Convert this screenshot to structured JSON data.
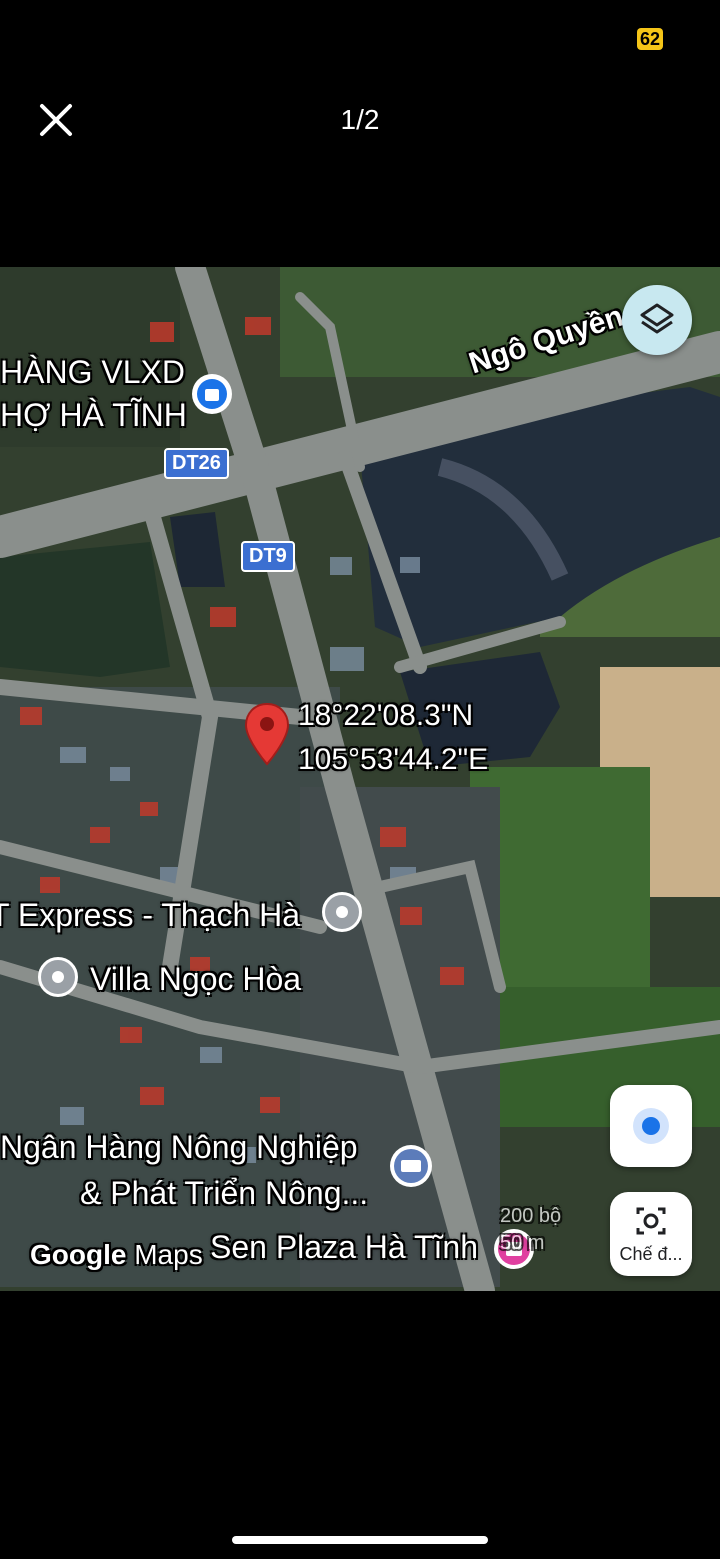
{
  "status_bar": {
    "badge": "62"
  },
  "header": {
    "page_counter": "1/2"
  },
  "map": {
    "places": {
      "store_line1": "HÀNG VLXD",
      "store_line2": "HỢ HÀ TĨNH",
      "street_name": "Ngô Quyền",
      "road_dt26": "DT26",
      "road_dt9": "DT9",
      "coord_lat": "18°22'08.3\"N",
      "coord_lng": "105°53'44.2\"E",
      "express": "T Express - Thạch Hà",
      "villa": "Villa Ngọc Hòa",
      "bank_line1": "Ngân Hàng Nông Nghiệp",
      "bank_line2": "& Phát Triển Nông...",
      "plaza": "Sen Plaza Hà Tĩnh"
    },
    "branding": {
      "google": "Google",
      "maps": "Maps"
    },
    "scale": {
      "line1": "200 bộ",
      "line2": "50 m"
    },
    "buttons": {
      "lens_label": "Chế đ..."
    },
    "colors": {
      "pin": "#e53935",
      "location_dot": "#1a73e8",
      "road_shield": "#3b6fd1",
      "plaza_icon": "#e040a0"
    }
  }
}
